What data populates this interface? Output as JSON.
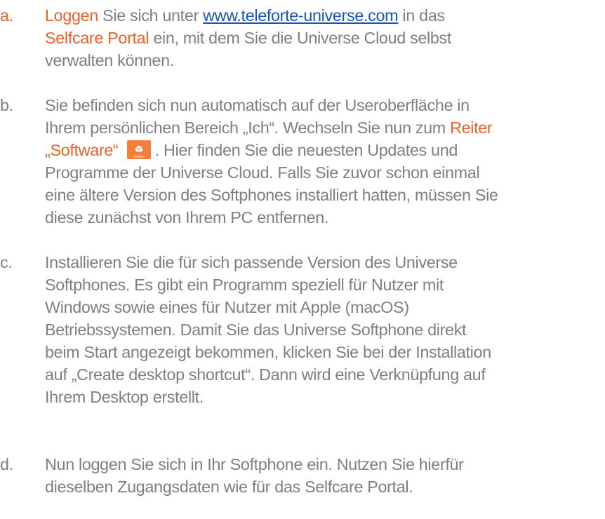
{
  "colors": {
    "accent": "#e8632b",
    "body_text": "#7f7f7f",
    "link": "#1a55b8"
  },
  "steps": [
    {
      "marker": "a.",
      "lines": [
        {
          "segments": [
            {
              "text": "Loggen",
              "style": "accent"
            },
            {
              "text": " Sie sich unter ",
              "style": "plain"
            },
            {
              "text": "www.teleforte-universe.com",
              "style": "link"
            },
            {
              "text": " in das",
              "style": "plain"
            }
          ]
        },
        {
          "segments": [
            {
              "text": "Selfcare Portal",
              "style": "accent"
            },
            {
              "text": " ein, mit dem Sie die Universe Cloud selbst",
              "style": "plain"
            }
          ]
        },
        {
          "segments": [
            {
              "text": "verwalten können.",
              "style": "plain"
            }
          ]
        }
      ]
    },
    {
      "marker": "b.",
      "lines": [
        {
          "segments": [
            {
              "text": "Sie befinden sich nun automatisch auf der Useroberfläche in",
              "style": "plain"
            }
          ]
        },
        {
          "segments": [
            {
              "text": "Ihrem persönlichen Bereich „Ich“. Wechseln Sie nun zum ",
              "style": "plain"
            },
            {
              "text": "Reiter",
              "style": "accent"
            }
          ]
        },
        {
          "segments": [
            {
              "text": "„Software“",
              "style": "accent"
            },
            {
              "text": " ",
              "style": "plain"
            },
            {
              "text": "",
              "style": "icon"
            },
            {
              "text": " . Hier finden Sie die neuesten Updates und",
              "style": "plain"
            }
          ]
        },
        {
          "segments": [
            {
              "text": "Programme der Universe Cloud. Falls Sie zuvor schon einmal",
              "style": "plain"
            }
          ]
        },
        {
          "segments": [
            {
              "text": "eine ältere Version des Softphones installiert hatten, müssen Sie",
              "style": "plain"
            }
          ]
        },
        {
          "segments": [
            {
              "text": "diese zunächst von Ihrem PC entfernen.",
              "style": "plain"
            }
          ]
        }
      ]
    },
    {
      "marker": "c.",
      "lines": [
        {
          "segments": [
            {
              "text": "Installieren Sie die für sich passende Version des Universe",
              "style": "plain"
            }
          ]
        },
        {
          "segments": [
            {
              "text": "Softphones. Es gibt ein Programm speziell für Nutzer mit",
              "style": "plain"
            }
          ]
        },
        {
          "segments": [
            {
              "text": "Windows sowie eines für Nutzer mit Apple (macOS)",
              "style": "plain"
            }
          ]
        },
        {
          "segments": [
            {
              "text": "Betriebssystemen. Damit Sie das Universe Softphone direkt",
              "style": "plain"
            }
          ]
        },
        {
          "segments": [
            {
              "text": "beim Start angezeigt bekommen, klicken Sie bei der Installation",
              "style": "plain"
            }
          ]
        },
        {
          "segments": [
            {
              "text": "auf „Create desktop shortcut“. Dann wird eine Verknüpfung auf",
              "style": "plain"
            }
          ]
        },
        {
          "segments": [
            {
              "text": "Ihrem Desktop erstellt.",
              "style": "plain"
            }
          ]
        }
      ]
    },
    {
      "marker": "d.",
      "lines": [
        {
          "segments": [
            {
              "text": "Nun loggen Sie sich in Ihr Softphone ein. Nutzen Sie hierfür",
              "style": "plain"
            }
          ]
        },
        {
          "segments": [
            {
              "text": "dieselben Zugangsdaten wie für das Selfcare Portal.",
              "style": "plain"
            }
          ]
        }
      ]
    }
  ],
  "software_icon": {
    "icon": "software-package-icon",
    "caption": "Software",
    "color": "#f07f3c"
  }
}
